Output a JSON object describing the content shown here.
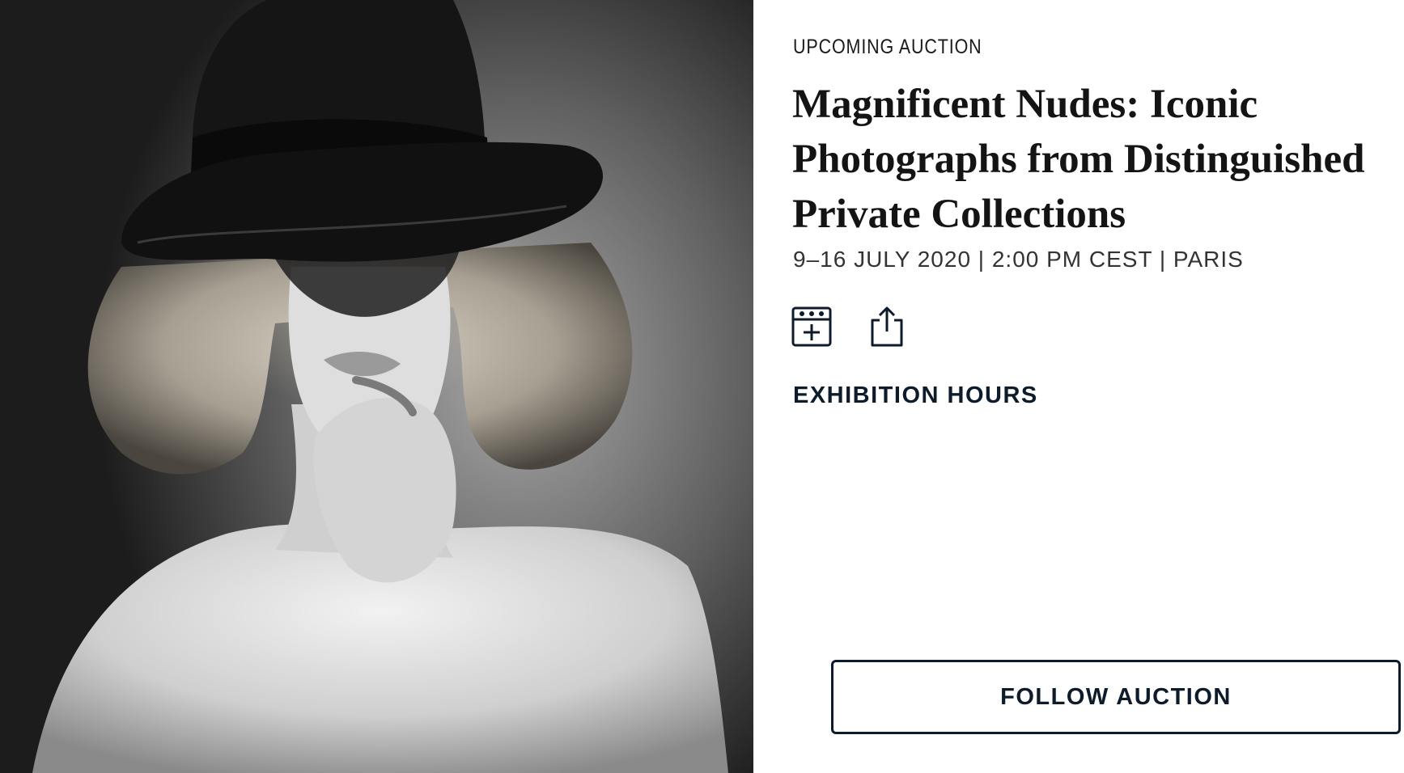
{
  "hero": {
    "image_alt": "Black and white photograph of a woman wearing a dark hat"
  },
  "auction": {
    "eyebrow": "UPCOMING AUCTION",
    "title": "Magnificent Nudes: Iconic Photographs from Distinguished Private Collections",
    "date_line": "9–16 JULY 2020 | 2:00 PM CEST | PARIS"
  },
  "actions": {
    "calendar_icon": "add-to-calendar-icon",
    "share_icon": "share-icon",
    "exhibition_label": "EXHIBITION HOURS",
    "follow_label": "FOLLOW AUCTION"
  },
  "colors": {
    "navy": "#0d1b2a",
    "text": "#141414",
    "muted": "#333333",
    "background": "#ffffff"
  }
}
